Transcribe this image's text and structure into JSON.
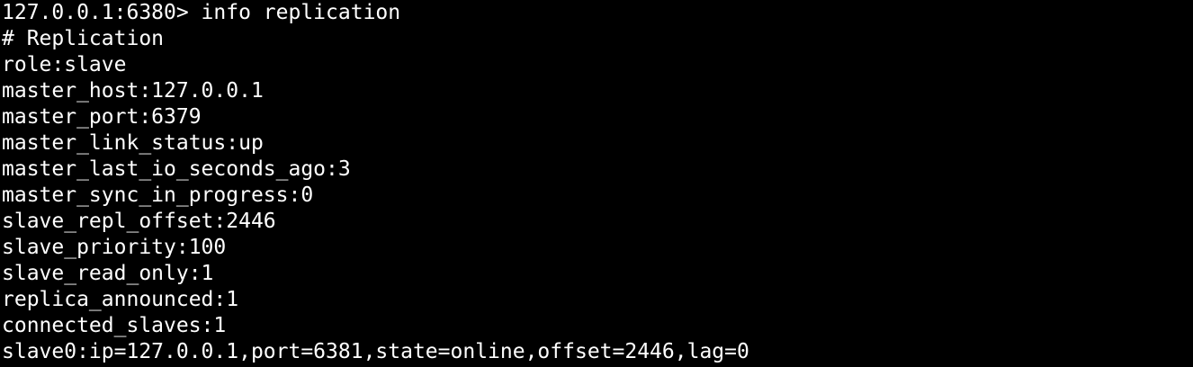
{
  "terminal": {
    "lines": [
      "127.0.0.1:6380> info replication",
      "# Replication",
      "role:slave",
      "master_host:127.0.0.1",
      "master_port:6379",
      "master_link_status:up",
      "master_last_io_seconds_ago:3",
      "master_sync_in_progress:0",
      "slave_repl_offset:2446",
      "slave_priority:100",
      "slave_read_only:1",
      "replica_announced:1",
      "connected_slaves:1",
      "slave0:ip=127.0.0.1,port=6381,state=online,offset=2446,lag=0"
    ],
    "colors": {
      "background": "#000000",
      "foreground": "#ffffff"
    }
  }
}
